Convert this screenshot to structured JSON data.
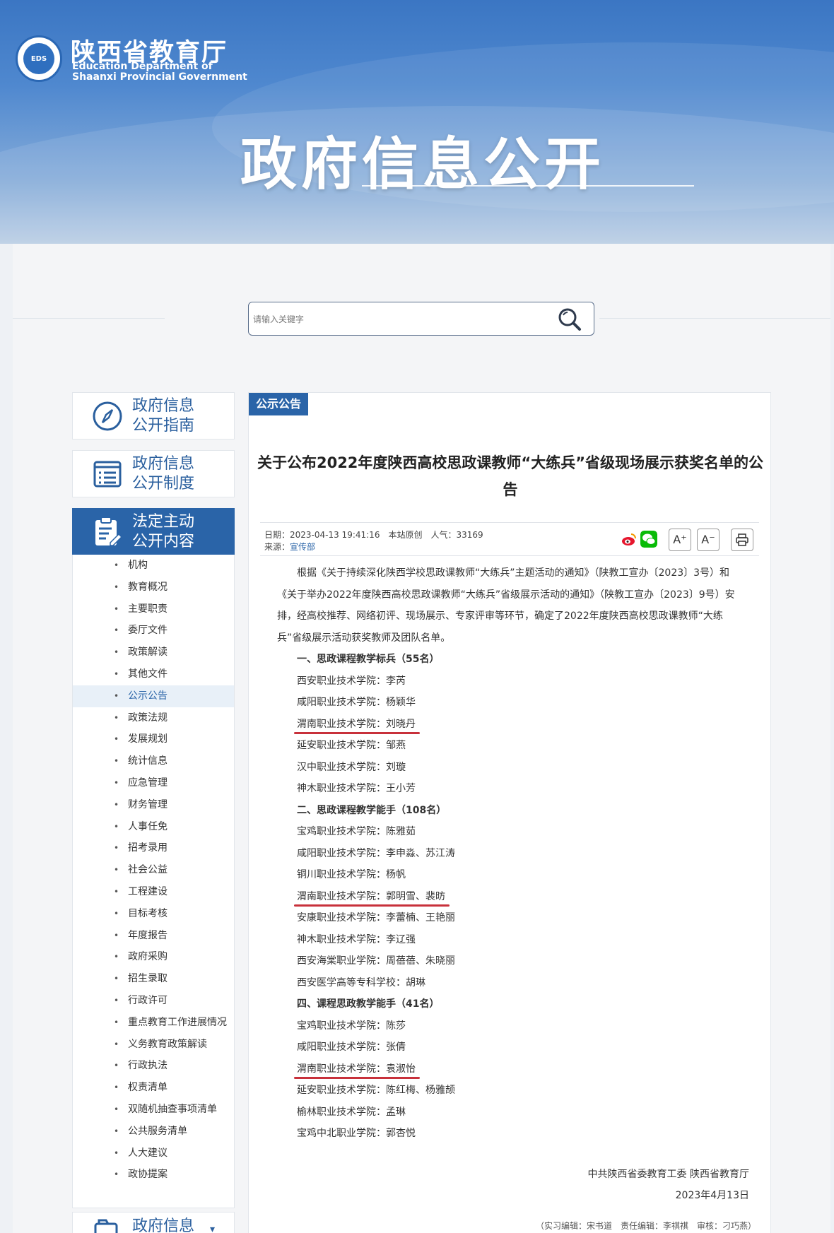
{
  "header": {
    "dept_name_cn": "陕西省教育厅",
    "dept_name_en_1": "Education Department of",
    "dept_name_en_2": "Shaanxi Provincial Government",
    "emblem_text": "EDS",
    "section_title": "政府信息公开"
  },
  "search": {
    "placeholder": "请输入关键字",
    "icon": "search-icon"
  },
  "sidebar": {
    "cards": [
      {
        "label": "政府信息公开指南",
        "line1": "政府信息",
        "line2": "公开指南",
        "icon": "compass-icon"
      },
      {
        "label": "政府信息公开制度",
        "line1": "政府信息",
        "line2": "公开制度",
        "icon": "list-document-icon"
      },
      {
        "label": "法定主动公开内容",
        "line1": "法定主动",
        "line2": "公开内容",
        "icon": "clipboard-edit-icon"
      },
      {
        "label": "政府信息",
        "line1": "政府信息",
        "line2": "",
        "icon": "folder-icon"
      }
    ],
    "items": [
      "机构",
      "教育概况",
      "主要职责",
      "委厅文件",
      "政策解读",
      "其他文件",
      "公示公告",
      "政策法规",
      "发展规划",
      "统计信息",
      "应急管理",
      "财务管理",
      "人事任免",
      "招考录用",
      "社会公益",
      "工程建设",
      "目标考核",
      "年度报告",
      "政府采购",
      "招生录取",
      "行政许可",
      "重点教育工作进展情况",
      "义务教育政策解读",
      "行政执法",
      "权责清单",
      "双随机抽查事项清单",
      "公共服务清单",
      "人大建议",
      "政协提案"
    ],
    "active_item": "公示公告",
    "colors": {
      "active_bg": "#2a64a8",
      "active_item_bg": "#e8f0f8"
    }
  },
  "article": {
    "tag": "公示公告",
    "title": "关于公布2022年度陕西高校思政课教师“大练兵”省级现场展示获奖名单的公告",
    "meta": {
      "line1": "日期：2023-04-13 19:41:16　本站原创　人气：33169",
      "source_label": "来源：",
      "source": "宣传部"
    },
    "tools": {
      "font_up": "A⁺",
      "font_down": "A⁻",
      "print_icon": "printer-icon",
      "weibo_icon": "weibo-icon",
      "wechat_icon": "wechat-icon"
    },
    "intro": "根据《关于持续深化陕西学校思政课教师“大练兵”主题活动的通知》（陕教工宣办〔2023〕3号）和《关于举办2022年度陕西高校思政课教师“大练兵”省级展示活动的通知》（陕教工宣办〔2023〕9号）安排，经高校推荐、网络初评、现场展示、专家评审等环节，确定了2022年度陕西高校思政课教师“大练兵”省级展示活动获奖教师及团队名单。",
    "lines": [
      {
        "text": "一、思政课程教学标兵（55名）",
        "head": true
      },
      {
        "text": "西安职业技术学院：李芮"
      },
      {
        "text": "咸阳职业技术学院：杨颖华"
      },
      {
        "text": "渭南职业技术学院：刘晓丹",
        "underline": true
      },
      {
        "text": "延安职业技术学院：邹燕"
      },
      {
        "text": "汉中职业技术学院：刘璇"
      },
      {
        "text": "神木职业技术学院：王小芳"
      },
      {
        "text": "二、思政课程教学能手（108名）",
        "head": true
      },
      {
        "text": "宝鸡职业技术学院：陈雅茹"
      },
      {
        "text": "咸阳职业技术学院：李申淼、苏江涛"
      },
      {
        "text": "铜川职业技术学院：杨帆"
      },
      {
        "text": "渭南职业技术学院：郭明雪、裴昉",
        "underline": true
      },
      {
        "text": "安康职业技术学院：李蕾楠、王艳丽"
      },
      {
        "text": "神木职业技术学院：李辽强"
      },
      {
        "text": "西安海棠职业学院：周蓓蓓、朱晓丽"
      },
      {
        "text": "西安医学高等专科学校：胡琳"
      },
      {
        "text": "四、课程思政教学能手（41名）",
        "head": true
      },
      {
        "text": "宝鸡职业技术学院：陈莎"
      },
      {
        "text": "咸阳职业技术学院：张倩"
      },
      {
        "text": "渭南职业技术学院：袁淑怡",
        "underline": true
      },
      {
        "text": "延安职业技术学院：陈红梅、杨雅颉"
      },
      {
        "text": "榆林职业技术学院：孟琳"
      },
      {
        "text": "宝鸡中北职业学院：郭杏悦"
      }
    ],
    "signature_org": "中共陕西省委教育工委 陕西省教育厅",
    "signature_date": "2023年4月13日",
    "editors": "（实习编辑：宋书道　责任编辑：李祺祺　审核：刁巧燕）",
    "colors": {
      "underline": "#c8313b",
      "link": "#2a64a8"
    }
  }
}
